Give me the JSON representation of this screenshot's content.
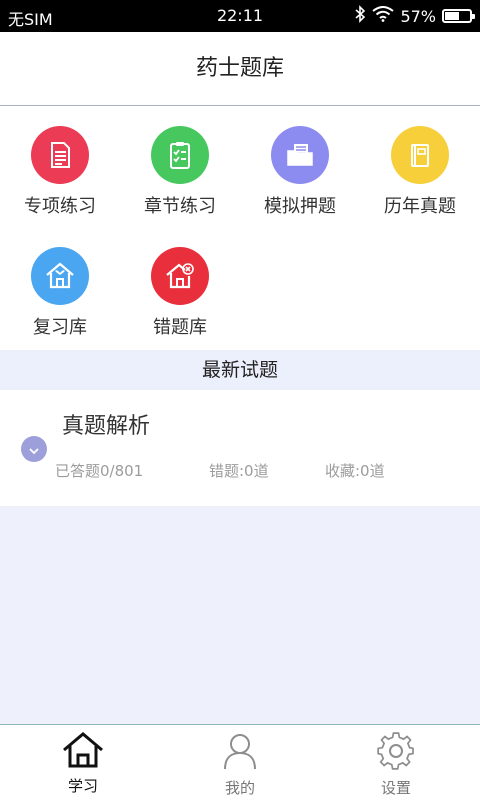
{
  "status_bar": {
    "carrier": "无SIM",
    "time": "22:11",
    "battery": "57%",
    "battery_level": 0.57
  },
  "header": {
    "title": "药士题库"
  },
  "categories": [
    {
      "label": "专项练习",
      "icon": "document-icon",
      "color": "#ec3b54"
    },
    {
      "label": "章节练习",
      "icon": "clipboard-checklist-icon",
      "color": "#47c85f"
    },
    {
      "label": "模拟押题",
      "icon": "folder-document-icon",
      "color": "#8c8cf0"
    },
    {
      "label": "历年真题",
      "icon": "book-icon",
      "color": "#f6cf3a"
    },
    {
      "label": "复习库",
      "icon": "home-heart-icon",
      "color": "#4aa6f0"
    },
    {
      "label": "错题库",
      "icon": "home-x-icon",
      "color": "#e82f3b"
    }
  ],
  "section": {
    "title": "最新试题"
  },
  "card": {
    "title": "真题解析",
    "answered": "已答题0/801",
    "wrong": "错题:0道",
    "favorites": "收藏:0道"
  },
  "tabbar": {
    "items": [
      {
        "label": "学习",
        "icon": "home-icon",
        "active": true
      },
      {
        "label": "我的",
        "icon": "person-icon",
        "active": false
      },
      {
        "label": "设置",
        "icon": "gear-icon",
        "active": false
      }
    ]
  }
}
